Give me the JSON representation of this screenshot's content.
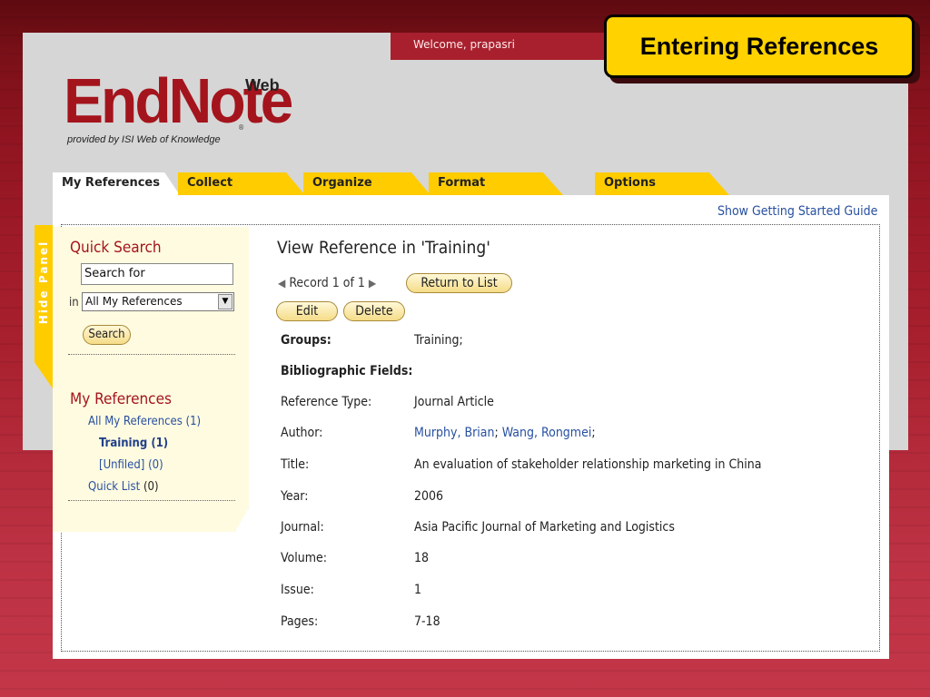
{
  "slide_title": "Entering References",
  "welcome_text": "Welcome, prapasri",
  "logo": {
    "main": "EndNote",
    "web": "Web",
    "tagline": "provided by ISI Web of Knowledge"
  },
  "tabs": [
    {
      "label": "My References",
      "active": true
    },
    {
      "label": "Collect"
    },
    {
      "label": "Organize"
    },
    {
      "label": "Format"
    },
    {
      "label": "Options"
    }
  ],
  "guide_link": "Show Getting Started Guide",
  "hide_panel_label": "Hide Panel",
  "quick_search": {
    "heading": "Quick Search",
    "input_value": "Search for",
    "in_label": "in",
    "scope_selected": "All My References",
    "button": "Search"
  },
  "my_references": {
    "heading": "My References",
    "all": "All My References (1)",
    "training": "Training (1)",
    "unfiled": "[Unfiled] (0)",
    "quick_list_link": "Quick List",
    "quick_list_count": "(0)"
  },
  "main": {
    "title": "View Reference in 'Training'",
    "record_text": "Record 1 of 1",
    "return_button": "Return to List",
    "edit_button": "Edit",
    "delete_button": "Delete",
    "groups_label": "Groups:",
    "groups_value": "Training;",
    "bib_label": "Bibliographic Fields:",
    "fields": {
      "type_label": "Reference Type:",
      "type_value": "Journal Article",
      "author_label": "Author:",
      "author1": "Murphy, Brian",
      "author2": "Wang, Rongmei",
      "title_label": "Title:",
      "title_value": "An evaluation of stakeholder relationship marketing in China",
      "year_label": "Year:",
      "year_value": "2006",
      "journal_label": "Journal:",
      "journal_value": "Asia Pacific Journal of Marketing and Logistics",
      "volume_label": "Volume:",
      "volume_value": "18",
      "issue_label": "Issue:",
      "issue_value": "1",
      "pages_label": "Pages:",
      "pages_value": "7-18"
    }
  },
  "colors": {
    "slide_red": "#a8202e",
    "callout_yellow": "#ffd200",
    "tab_yellow": "#ffcc00",
    "logo_red": "#a4141c",
    "link_blue": "#2850a0",
    "panel_bg": "#fffbe0"
  }
}
